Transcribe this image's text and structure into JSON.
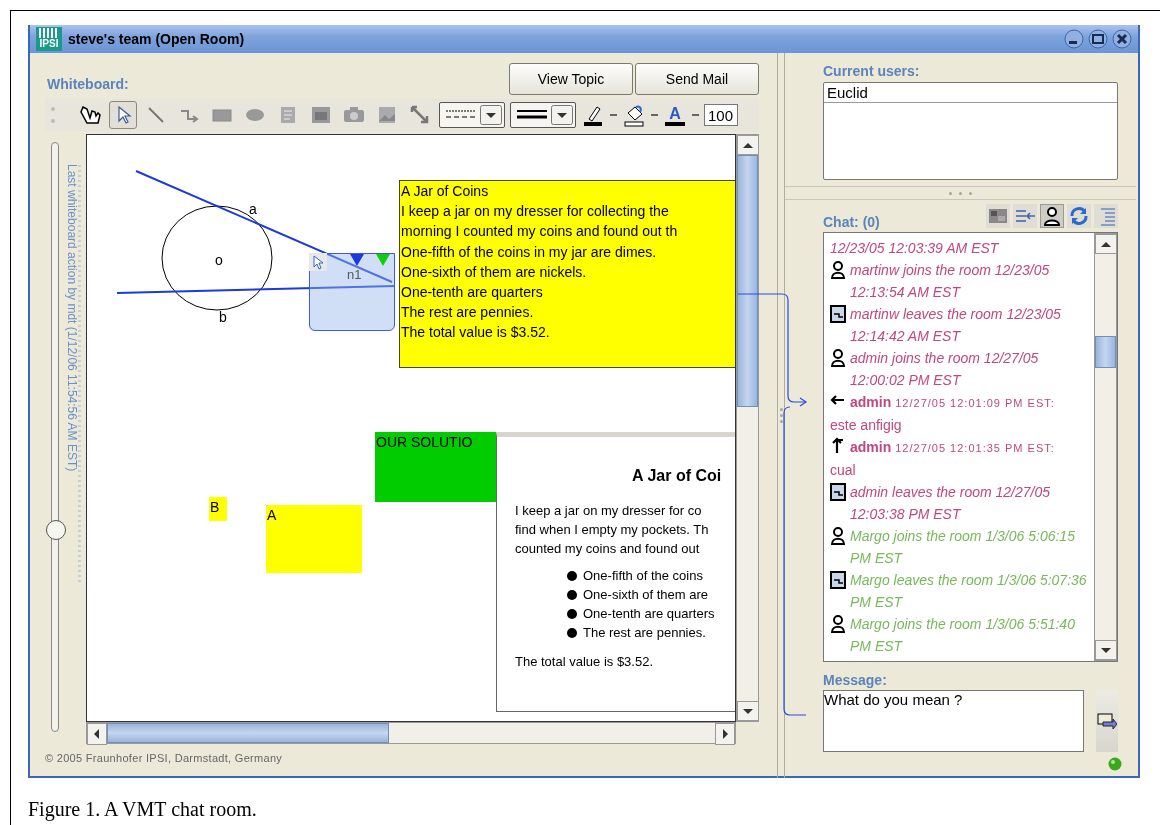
{
  "window": {
    "title": "steve's team (Open Room)",
    "logo": "IPSI"
  },
  "whiteboard": {
    "label": "Whiteboard:",
    "buttons": [
      "View Topic",
      "Send Mail"
    ],
    "tools": [
      {
        "kind": "hand",
        "selected": false
      },
      {
        "kind": "pointer",
        "selected": true
      },
      {
        "kind": "line",
        "selected": false
      },
      {
        "kind": "connector",
        "selected": false
      },
      {
        "kind": "rectangle",
        "selected": false
      },
      {
        "kind": "ellipse",
        "selected": false
      },
      {
        "kind": "textbox",
        "selected": false
      },
      {
        "kind": "webpage",
        "selected": false
      },
      {
        "kind": "camera",
        "selected": false
      },
      {
        "kind": "image",
        "selected": false
      },
      {
        "kind": "resize",
        "selected": false
      }
    ],
    "formatting": [
      {
        "kind": "dash-style"
      },
      {
        "kind": "line-width"
      },
      {
        "kind": "pen-color"
      },
      {
        "kind": "fill-color"
      },
      {
        "kind": "font-color",
        "glyph": "A"
      }
    ],
    "zoom": "100",
    "history_slider": {
      "caption": "Last whiteboard action by mdt (1/12/06 11:54:56 AM EST)",
      "level": 0.34
    },
    "objects": [
      {
        "kind": "label",
        "text": "a"
      },
      {
        "kind": "label",
        "text": "o"
      },
      {
        "kind": "label",
        "text": "b"
      },
      {
        "kind": "note",
        "color": "#ffff00",
        "lines": [
          "A Jar of Coins",
          "I keep a jar on my dresser for collecting the",
          "morning I counted my coins and found out th",
          "One-fifth of the coins in my jar are dimes.",
          "One-sixth of them are nickels.",
          "One-tenth are quarters",
          "The rest are pennies.",
          "The total value is $3.52."
        ]
      },
      {
        "kind": "reference",
        "label": "n1"
      },
      {
        "kind": "note",
        "color": "#00cc00",
        "lines": [
          "OUR SOLUTIO"
        ]
      },
      {
        "kind": "note",
        "color": "#ffff00",
        "lines": [
          "B"
        ]
      },
      {
        "kind": "note",
        "color": "#ffff00",
        "lines": [
          "A"
        ]
      },
      {
        "kind": "document",
        "title": "A Jar of Coi",
        "paragraph": [
          "I keep a jar on my dresser for co",
          "find when I empty my pockets. Th",
          "counted my coins and found out"
        ],
        "bullets": [
          "One-fifth of the coins",
          "One-sixth of them are",
          "One-tenth are quarters",
          "The rest are pennies."
        ],
        "closing": "The total value is $3.52."
      }
    ],
    "footer": "© 2005 Fraunhofer IPSI, Darmstadt, Germany"
  },
  "users": {
    "label": "Current users:",
    "items": [
      "Euclid"
    ]
  },
  "chat": {
    "label": "Chat: (0)",
    "tools": [
      {
        "kind": "grid",
        "selected": false
      },
      {
        "kind": "indent",
        "selected": false
      },
      {
        "kind": "person",
        "selected": true
      },
      {
        "kind": "refresh",
        "selected": false
      },
      {
        "kind": "list",
        "selected": false
      }
    ],
    "entries": [
      {
        "kind": "continuation",
        "text": "12/23/05 12:03:39 AM EST",
        "color": "#c0477f"
      },
      {
        "kind": "join",
        "text": "martinw joins the room 12/23/05 12:13:54 AM EST",
        "color": "#c0477f"
      },
      {
        "kind": "leave",
        "text": "martinw leaves the room 12/23/05 12:14:42 AM EST",
        "color": "#c0477f"
      },
      {
        "kind": "join",
        "text": "admin joins the room 12/27/05 12:00:02 PM EST",
        "color": "#c0477f"
      },
      {
        "kind": "incoming",
        "author": "admin",
        "time": "12/27/05 12:01:09 PM EST:",
        "text": "este anfigig",
        "color": "#c0477f"
      },
      {
        "kind": "outgoing",
        "author": "admin",
        "time": "12/27/05 12:01:35 PM EST:",
        "text": "cual",
        "color": "#c0477f"
      },
      {
        "kind": "leave",
        "text": "admin leaves the room 12/27/05 12:03:38 PM EST",
        "color": "#c0477f"
      },
      {
        "kind": "join",
        "text": "Margo joins the room 1/3/06 5:06:15 PM EST",
        "color": "#77b85a"
      },
      {
        "kind": "leave",
        "text": "Margo leaves the room 1/3/06 5:07:36 PM EST",
        "color": "#77b85a"
      },
      {
        "kind": "join",
        "text": "Margo joins the room 1/3/06 5:51:40 PM EST",
        "color": "#77b85a"
      }
    ]
  },
  "message": {
    "label": "Message:",
    "value": "What do you mean ?"
  },
  "caption": "Figure 1. A VMT chat room."
}
